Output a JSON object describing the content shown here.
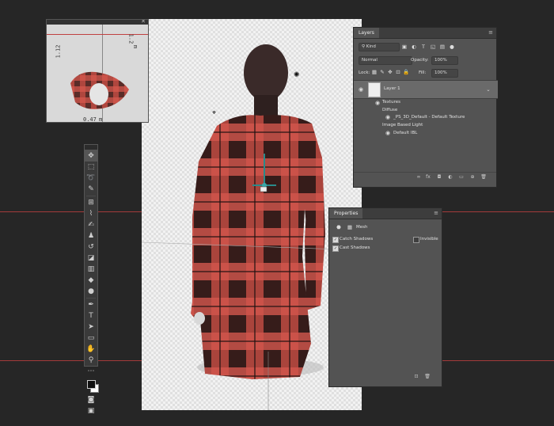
{
  "navigator": {
    "measure_top": "1.12",
    "measure_side": "1.2",
    "measure_unit": "m",
    "measure_bottom": "0.47",
    "measure_bottom_unit": "m"
  },
  "layers": {
    "tab": "Layers",
    "filter_kind": "Kind",
    "blend_mode": "Normal",
    "opacity_label": "Opacity:",
    "opacity_value": "100%",
    "lock_label": "Lock:",
    "fill_label": "Fill:",
    "fill_value": "100%",
    "layer_name": "Layer 1",
    "sub_items": [
      "Textures",
      "Diffuse",
      "_PS_3D_Default - Default Texture",
      "Image Based Light",
      "Default IBL"
    ]
  },
  "properties": {
    "tab": "Properties",
    "section": "Mesh",
    "catch_shadows": "Catch Shadows",
    "cast_shadows": "Cast Shadows",
    "invisible": "Invisible"
  },
  "icons": {
    "toolbar": [
      "move-tool-icon",
      "marquee-tool-icon",
      "lasso-tool-icon",
      "quick-select-tool-icon",
      "crop-tool-icon",
      "eyedropper-tool-icon",
      "brush-tool-icon",
      "stamp-tool-icon",
      "history-brush-icon",
      "eraser-tool-icon",
      "gradient-tool-icon",
      "blur-tool-icon",
      "dodge-tool-icon",
      "pen-tool-icon",
      "type-tool-icon",
      "path-select-tool-icon",
      "shape-tool-icon",
      "hand-tool-icon",
      "zoom-tool-icon",
      "more-tools-icon"
    ]
  },
  "colors": {
    "guide": "#a33a3a",
    "plaid_red": "#d9594f",
    "plaid_dark": "#3a1f1d"
  }
}
